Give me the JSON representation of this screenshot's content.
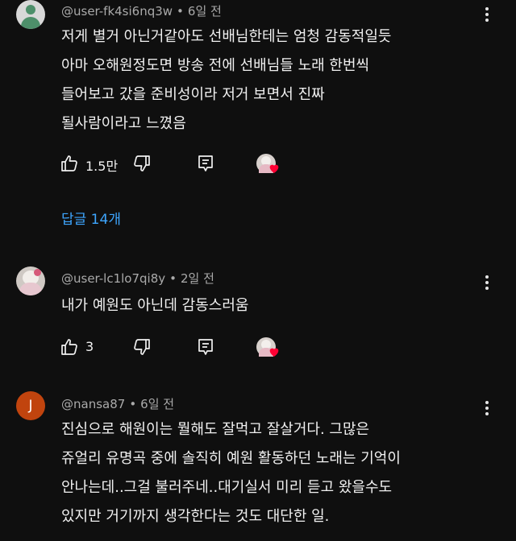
{
  "comments": [
    {
      "avatar": "user-silhouette",
      "author": "@user-fk4si6nq3w",
      "time": "6일 전",
      "lines": [
        "저게 별거 아닌거같아도 선배님한테는 엄청 감동적일듯",
        "아마 오해원정도면 방송 전에 선배님들 노래 한번씩",
        "들어보고 갔을 준비성이라 저거 보면서 진짜",
        "될사람이라고 느꼈음"
      ],
      "likes": "1.5만",
      "replies_label": "답글 14개"
    },
    {
      "avatar": "profile-photo",
      "author": "@user-lc1lo7qi8y",
      "time": "2일 전",
      "lines": [
        "내가 예원도 아닌데 감동스러움"
      ],
      "likes": "3"
    },
    {
      "avatar_letter": "J",
      "author": "@nansa87",
      "time": "6일 전",
      "lines": [
        "진심으로 해원이는 뭘해도 잘먹고 잘살거다. 그많은",
        "쥬얼리 유명곡 중에 솔직히 예원 활동하던 노래는 기억이",
        "안나는데..그걸 불러주네..대기실서 미리 듣고 왔을수도",
        "있지만 거기까지 생각한다는 것도 대단한 일."
      ]
    }
  ],
  "icons": {
    "like": "thumbs-up-icon",
    "dislike": "thumbs-down-icon",
    "reply": "reply-icon",
    "more": "more-vertical-icon",
    "creator_heart": "heart-icon"
  },
  "colors": {
    "background": "#0f0f0f",
    "text": "#f1f1f1",
    "meta": "#aaaaaa",
    "link": "#3ea6ff",
    "heart": "#ff0033",
    "letter_avatar": "#c1440e"
  }
}
